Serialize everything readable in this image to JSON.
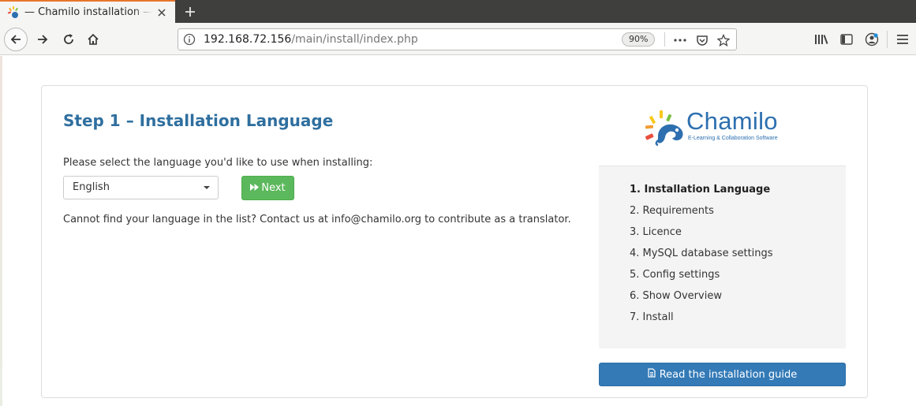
{
  "browser": {
    "tab_title": "— Chamilo installation — Mozilla Firefox",
    "url_host": "192.168.72.156",
    "url_path": "/main/install/index.php",
    "zoom_level": "90%"
  },
  "install": {
    "step_title": "Step 1 – Installation Language",
    "select_prompt": "Please select the language you'd like to use when installing:",
    "selected_language": "English",
    "next_label": "Next",
    "help_text": "Cannot find your language in the list? Contact us at info@chamilo.org to contribute as a translator."
  },
  "logo": {
    "name": "Chamilo",
    "tagline": "E-Learning & Collaboration Software"
  },
  "steps": [
    {
      "label": "1. Installation Language",
      "active": true
    },
    {
      "label": "2. Requirements",
      "active": false
    },
    {
      "label": "3. Licence",
      "active": false
    },
    {
      "label": "4. MySQL database settings",
      "active": false
    },
    {
      "label": "5. Config settings",
      "active": false
    },
    {
      "label": "6. Show Overview",
      "active": false
    },
    {
      "label": "7. Install",
      "active": false
    }
  ],
  "guide_button": {
    "label": "Read the installation guide",
    "icon": "document-icon"
  },
  "colors": {
    "heading_blue": "#2f6f9f",
    "next_green": "#5cb85c",
    "guide_blue": "#337ab7",
    "tab_accent": "#e8762c"
  }
}
